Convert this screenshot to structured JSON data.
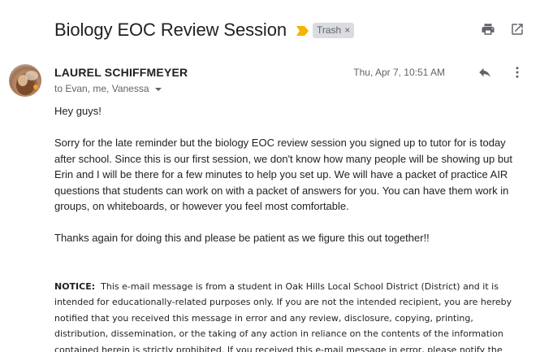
{
  "header": {
    "subject": "Biology EOC Review Session",
    "label": "Trash",
    "label_remove": "×",
    "print_icon": "print-icon",
    "popout_icon": "open-in-new-window-icon"
  },
  "message": {
    "sender": "LAUREL SCHIFFMEYER",
    "recipients": "to Evan, me, Vanessa",
    "date": "Thu, Apr 7, 10:51 AM",
    "reply_icon": "reply-icon",
    "more_icon": "more-vertical-icon",
    "body": [
      "Hey guys!",
      "Sorry for the late reminder but the biology EOC review session you signed up to tutor for is today after school. Since this is our first session, we don't know how many people will be showing up but Erin and I will be there for a few minutes to help you set up. We will have a packet of practice AIR questions that students can work on with a packet of answers for you. You can have them work in groups, on whiteboards, or however you feel most comfortable.",
      "Thanks again for doing this and please be patient as we figure this out together!!"
    ],
    "notice_label": "NOTICE:",
    "notice_text": "This e-mail message is from a student in Oak Hills Local School District (District) and it is intended for educationally-related purposes only.  If you are not the intended recipient, you are hereby notified that you received this message in error and any review, disclosure, copying, printing, distribution, dissemination, or the taking of any action in reliance on the contents of the information contained herein is strictly prohibited.  If you received this e-mail message in error, please notify the"
  },
  "colors": {
    "importance_marker": "#f5b400",
    "label_bg": "#dadce0",
    "secondary_text": "#5f6368"
  }
}
